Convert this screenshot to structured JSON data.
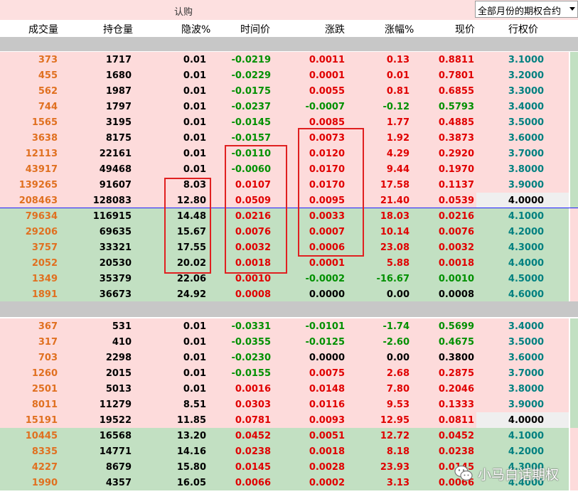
{
  "window": {
    "section_title": "认购",
    "month_select": "全部月份的期权合约"
  },
  "columns": [
    "成交量",
    "持仓量",
    "隐波%",
    "时间价",
    "涨跌",
    "涨幅%",
    "现价",
    "行权价"
  ],
  "group1": [
    {
      "vol": "373",
      "oi": "1717",
      "iv": "0.01",
      "tv": "-0.0219",
      "chg": "0.0011",
      "pct": "0.13",
      "price": "0.8811",
      "strike": "3.1000",
      "itm": true
    },
    {
      "vol": "455",
      "oi": "1680",
      "iv": "0.01",
      "tv": "-0.0229",
      "chg": "0.0001",
      "pct": "0.01",
      "price": "0.7801",
      "strike": "3.2000",
      "itm": true
    },
    {
      "vol": "562",
      "oi": "1987",
      "iv": "0.01",
      "tv": "-0.0175",
      "chg": "0.0055",
      "pct": "0.81",
      "price": "0.6855",
      "strike": "3.3000",
      "itm": true
    },
    {
      "vol": "744",
      "oi": "1797",
      "iv": "0.01",
      "tv": "-0.0237",
      "chg": "-0.0007",
      "pct": "-0.12",
      "price": "0.5793",
      "strike": "3.4000",
      "itm": true
    },
    {
      "vol": "1565",
      "oi": "3195",
      "iv": "0.01",
      "tv": "-0.0145",
      "chg": "0.0085",
      "pct": "1.77",
      "price": "0.4885",
      "strike": "3.5000",
      "itm": true
    },
    {
      "vol": "3638",
      "oi": "8175",
      "iv": "0.01",
      "tv": "-0.0157",
      "chg": "0.0073",
      "pct": "1.92",
      "price": "0.3873",
      "strike": "3.6000",
      "itm": true
    },
    {
      "vol": "12113",
      "oi": "22161",
      "iv": "0.01",
      "tv": "-0.0110",
      "chg": "0.0120",
      "pct": "4.29",
      "price": "0.2920",
      "strike": "3.7000",
      "itm": true
    },
    {
      "vol": "43917",
      "oi": "49468",
      "iv": "0.01",
      "tv": "-0.0060",
      "chg": "0.0170",
      "pct": "9.44",
      "price": "0.1970",
      "strike": "3.8000",
      "itm": true
    },
    {
      "vol": "139265",
      "oi": "91607",
      "iv": "8.03",
      "tv": "0.0107",
      "chg": "0.0170",
      "pct": "17.58",
      "price": "0.1137",
      "strike": "3.9000",
      "itm": true
    },
    {
      "vol": "208463",
      "oi": "128083",
      "iv": "12.80",
      "tv": "0.0509",
      "chg": "0.0095",
      "pct": "21.40",
      "price": "0.0539",
      "strike": "4.0000",
      "itm": true
    },
    {
      "vol": "79634",
      "oi": "116915",
      "iv": "14.48",
      "tv": "0.0216",
      "chg": "0.0033",
      "pct": "18.03",
      "price": "0.0216",
      "strike": "4.1000",
      "itm": false
    },
    {
      "vol": "29206",
      "oi": "69635",
      "iv": "15.67",
      "tv": "0.0076",
      "chg": "0.0007",
      "pct": "10.14",
      "price": "0.0076",
      "strike": "4.2000",
      "itm": false
    },
    {
      "vol": "3757",
      "oi": "33321",
      "iv": "17.55",
      "tv": "0.0032",
      "chg": "0.0006",
      "pct": "23.08",
      "price": "0.0032",
      "strike": "4.3000",
      "itm": false
    },
    {
      "vol": "2052",
      "oi": "20530",
      "iv": "20.02",
      "tv": "0.0018",
      "chg": "0.0001",
      "pct": "5.88",
      "price": "0.0018",
      "strike": "4.4000",
      "itm": false
    },
    {
      "vol": "1349",
      "oi": "35379",
      "iv": "22.06",
      "tv": "0.0010",
      "chg": "-0.0002",
      "pct": "-16.67",
      "price": "0.0010",
      "strike": "4.5000",
      "itm": false
    },
    {
      "vol": "1891",
      "oi": "36673",
      "iv": "24.92",
      "tv": "0.0008",
      "chg": "0.0000",
      "pct": "0.00",
      "price": "0.0008",
      "strike": "4.6000",
      "itm": false
    }
  ],
  "group2": [
    {
      "vol": "367",
      "oi": "531",
      "iv": "0.01",
      "tv": "-0.0331",
      "chg": "-0.0101",
      "pct": "-1.74",
      "price": "0.5699",
      "strike": "3.4000",
      "itm": true
    },
    {
      "vol": "317",
      "oi": "410",
      "iv": "0.01",
      "tv": "-0.0355",
      "chg": "-0.0125",
      "pct": "-2.60",
      "price": "0.4675",
      "strike": "3.5000",
      "itm": true
    },
    {
      "vol": "703",
      "oi": "2298",
      "iv": "0.01",
      "tv": "-0.0230",
      "chg": "0.0000",
      "pct": "0.00",
      "price": "0.3800",
      "strike": "3.6000",
      "itm": true
    },
    {
      "vol": "1260",
      "oi": "2015",
      "iv": "0.01",
      "tv": "-0.0155",
      "chg": "0.0075",
      "pct": "2.68",
      "price": "0.2875",
      "strike": "3.7000",
      "itm": true
    },
    {
      "vol": "2501",
      "oi": "5013",
      "iv": "0.01",
      "tv": "0.0016",
      "chg": "0.0148",
      "pct": "7.80",
      "price": "0.2046",
      "strike": "3.8000",
      "itm": true
    },
    {
      "vol": "8011",
      "oi": "11279",
      "iv": "8.51",
      "tv": "0.0303",
      "chg": "0.0116",
      "pct": "9.53",
      "price": "0.1333",
      "strike": "3.9000",
      "itm": true
    },
    {
      "vol": "15191",
      "oi": "19522",
      "iv": "11.85",
      "tv": "0.0781",
      "chg": "0.0093",
      "pct": "12.95",
      "price": "0.0811",
      "strike": "4.0000",
      "itm": true
    },
    {
      "vol": "10445",
      "oi": "16568",
      "iv": "13.20",
      "tv": "0.0452",
      "chg": "0.0051",
      "pct": "12.72",
      "price": "0.0452",
      "strike": "4.1000",
      "itm": false
    },
    {
      "vol": "8335",
      "oi": "14771",
      "iv": "14.16",
      "tv": "0.0238",
      "chg": "0.0018",
      "pct": "8.18",
      "price": "0.0238",
      "strike": "4.2000",
      "itm": false
    },
    {
      "vol": "4227",
      "oi": "8679",
      "iv": "15.80",
      "tv": "0.0145",
      "chg": "0.0028",
      "pct": "23.93",
      "price": "0.0145",
      "strike": "4.3000",
      "itm": false
    },
    {
      "vol": "1990",
      "oi": "4357",
      "iv": "16.05",
      "tv": "0.0066",
      "chg": "0.0002",
      "pct": "3.13",
      "price": "0.0066",
      "strike": "4.4000",
      "itm": false
    }
  ],
  "watermark": {
    "icon": "wechat-icon",
    "text": "小马白话期权"
  },
  "colors": {
    "itm_bg": "#fddbdb",
    "otm_bg": "#c2e0c2",
    "up": "#e00000",
    "down": "#009000",
    "volume": "#e07020",
    "strike": "#008080",
    "highlight_box": "#e02020"
  }
}
